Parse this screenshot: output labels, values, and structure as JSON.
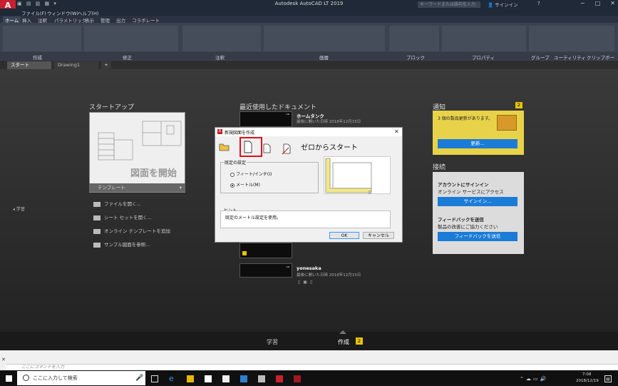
{
  "window": {
    "app_title": "Autodesk AutoCAD LT 2019",
    "logo_text": "A",
    "search_placeholder": "キーワードまたは語句を入力",
    "signin": "サインイン",
    "help": "?"
  },
  "menubar": [
    "ファイル(F)",
    "ウィンドウ(W)",
    "ヘルプ(H)"
  ],
  "ribbon_tabs": [
    "ホーム",
    "挿入",
    "注釈",
    "パラメトリック",
    "表示",
    "管理",
    "出力",
    "コラボレート"
  ],
  "ribbon_panels": [
    "作成",
    "修正",
    "注釈",
    "画層",
    "ブロック",
    "プロパティ",
    "グループ",
    "ユーティリティ",
    "クリップボード"
  ],
  "doc_tabs": {
    "start": "スタート",
    "drawing": "Drawing1",
    "plus": "+"
  },
  "start": {
    "startup_title": "スタートアップ",
    "start_drawing": "図面を開始",
    "template": "テンプレート",
    "links": [
      "ファイルを開く...",
      "シート セットを開く...",
      "オンライン テンプレートを追加",
      "サンプル図面を参照..."
    ],
    "learn_nav": "学習"
  },
  "recent": {
    "title": "最近使用したドキュメント",
    "items": [
      {
        "name": "ホームタンク",
        "date": "最後に開いた日時 2018年12月15日"
      },
      {
        "name": "yonesaka",
        "date": "最後に開いた日時 2018年12月15日"
      }
    ]
  },
  "notifications": {
    "title": "通知",
    "badge": "2",
    "text": "3 個の製品更新があります。",
    "update_button": "更新..."
  },
  "connect": {
    "title": "接続",
    "account_heading": "アカウントにサインイン",
    "account_sub": "オンライン サービスにアクセス",
    "signin_button": "サインイン...",
    "feedback_heading": "フィードバックを送信",
    "feedback_sub": "製品の改善にご協力ください",
    "feedback_button": "フィードバックを送信"
  },
  "dialog": {
    "title": "新規図面を作成",
    "heading": "ゼロからスタート",
    "group_label": "既定の設定",
    "radio_imperial": "フィート/インチ(I)",
    "radio_metric": "メートル(M)",
    "hint_label": "ヒント",
    "hint_text": "既定のメートル設定を使用。",
    "ok": "OK",
    "cancel": "キャンセル"
  },
  "bottom": {
    "learn": "学習",
    "create": "作成",
    "create_badge": "2"
  },
  "cmdline": {
    "placeholder": "ここにコマンドを入力"
  },
  "taskbar": {
    "search": "ここに入力して検索",
    "time": "7:08",
    "date": "2018/12/19"
  },
  "colors": {
    "accent_blue": "#1a7cd6",
    "autocad_red": "#c8202d",
    "notif_yellow": "#e8d24a",
    "highlight_red": "#e0101a"
  }
}
